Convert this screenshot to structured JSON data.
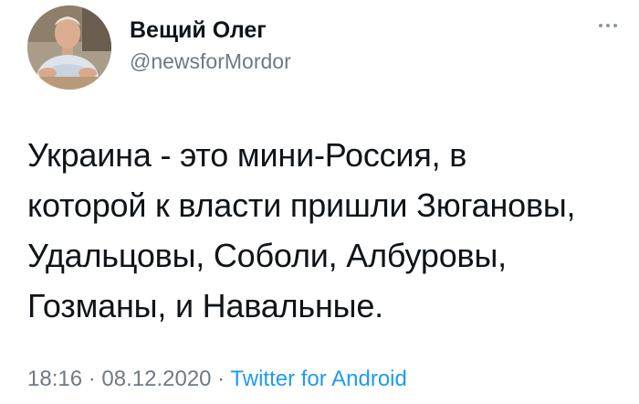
{
  "author": {
    "display_name": "Вещий Олег",
    "handle": "@newsforMordor"
  },
  "tweet": {
    "text": "Украина - это мини-Россия, в\nкоторой к власти пришли Зюгановы,\nУдальцовы, Соболи, Албуровы,\nГозманы, и Навальные."
  },
  "meta": {
    "time": "18:16",
    "separator_1": " · ",
    "date": "08.12.2020",
    "separator_2": " · ",
    "source": "Twitter for Android"
  },
  "icons": {
    "more": "more-icon"
  },
  "colors": {
    "text": "#0f1419",
    "secondary": "#6e7a85",
    "link": "#1d9bf0",
    "background": "#ffffff"
  }
}
